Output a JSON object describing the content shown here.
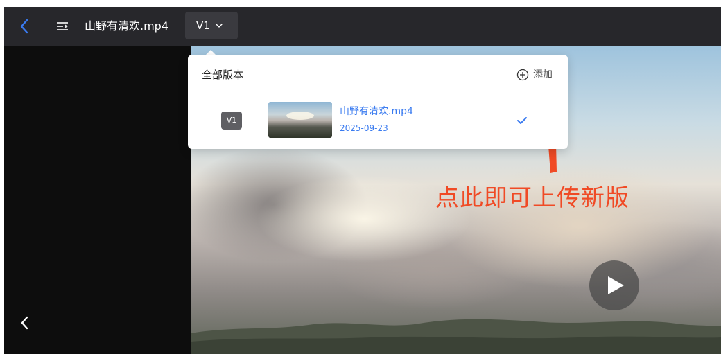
{
  "topbar": {
    "file_title": "山野有清欢.mp4",
    "version_label": "V1"
  },
  "popup": {
    "title": "全部版本",
    "add_label": "添加",
    "versions": [
      {
        "badge": "V1",
        "name": "山野有清欢.mp4",
        "date": "2025-09-23",
        "selected": true
      }
    ]
  },
  "annotation": {
    "text": "点此即可上传新版"
  },
  "colors": {
    "topbar_bg": "#27272b",
    "accent_blue": "#3a7bf0",
    "annotation_red": "#f04a25"
  },
  "icons": [
    "back-chevron-icon",
    "list-icon",
    "chevron-down-icon",
    "add-circle-icon",
    "check-icon",
    "chevron-left-icon",
    "play-icon",
    "arrow-annotation"
  ]
}
